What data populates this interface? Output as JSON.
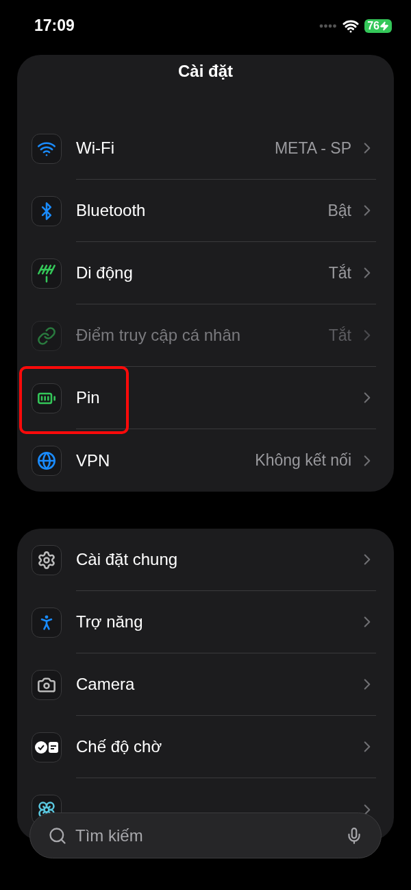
{
  "status_bar": {
    "time": "17:09",
    "battery": "76",
    "charging": true
  },
  "title": "Cài đặt",
  "groups": [
    {
      "rows": [
        {
          "kind": "wifi",
          "label": "Wi-Fi",
          "value": "META - SP",
          "disabled": false,
          "highlighted": false
        },
        {
          "kind": "bluetooth",
          "label": "Bluetooth",
          "value": "Bật",
          "disabled": false,
          "highlighted": false
        },
        {
          "kind": "antenna",
          "label": "Di động",
          "value": "Tắt",
          "disabled": false,
          "highlighted": false
        },
        {
          "kind": "link",
          "label": "Điểm truy cập cá nhân",
          "value": "Tắt",
          "disabled": true,
          "highlighted": false
        },
        {
          "kind": "battery",
          "label": "Pin",
          "disabled": false,
          "highlighted": true
        },
        {
          "kind": "globe",
          "label": "VPN",
          "value": "Không kết nối",
          "disabled": false,
          "highlighted": false
        }
      ]
    },
    {
      "rows": [
        {
          "kind": "gear",
          "label": "Cài đặt chung",
          "disabled": false,
          "highlighted": false
        },
        {
          "kind": "accessibility",
          "label": "Trợ năng",
          "disabled": false,
          "highlighted": false
        },
        {
          "kind": "camera",
          "label": "Camera",
          "disabled": false,
          "highlighted": false
        },
        {
          "kind": "standby",
          "label": "Chế độ chờ",
          "disabled": false,
          "highlighted": false
        },
        {
          "kind": "flower",
          "disabled": false,
          "highlighted": false
        }
      ]
    }
  ],
  "search": {
    "placeholder": "Tìm kiếm"
  }
}
